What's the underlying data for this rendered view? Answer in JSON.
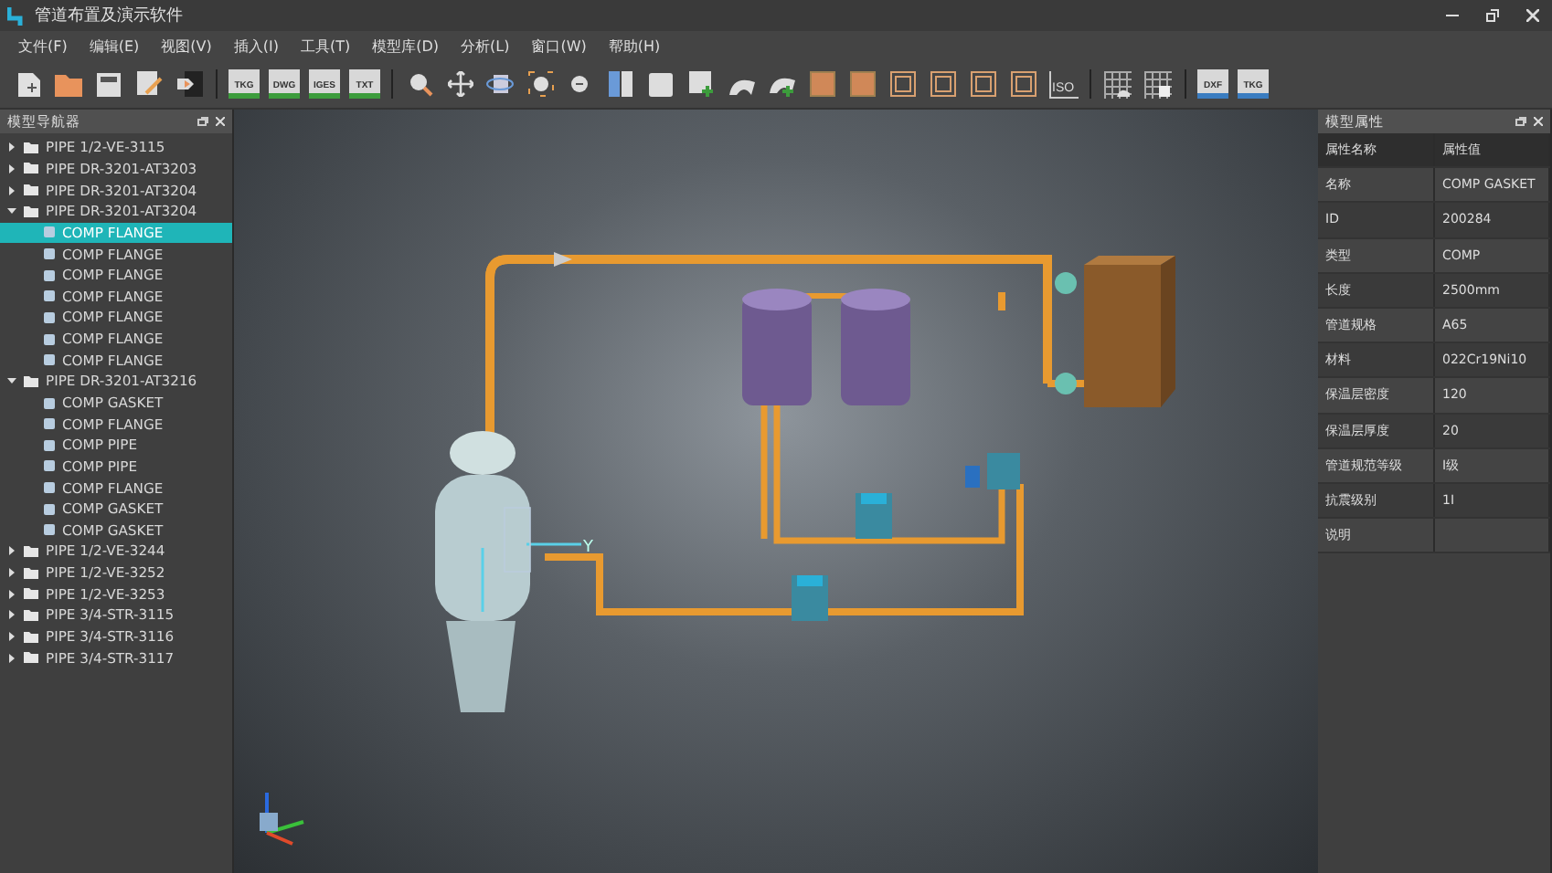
{
  "window": {
    "title": "管道布置及演示软件"
  },
  "menu": [
    "文件(F)",
    "编辑(E)",
    "视图(V)",
    "插入(I)",
    "工具(T)",
    "模型库(D)",
    "分析(L)",
    "窗口(W)",
    "帮助(H)"
  ],
  "toolbar": [
    [
      {
        "kind": "new"
      },
      {
        "kind": "open"
      },
      {
        "kind": "save"
      },
      {
        "kind": "edit"
      },
      {
        "kind": "import"
      }
    ],
    [
      {
        "kind": "file",
        "label": "TKG"
      },
      {
        "kind": "file",
        "label": "DWG"
      },
      {
        "kind": "file",
        "label": "IGES"
      },
      {
        "kind": "file",
        "label": "TXT"
      }
    ],
    [
      {
        "kind": "zoom"
      },
      {
        "kind": "pan"
      },
      {
        "kind": "rotate"
      },
      {
        "kind": "fit"
      },
      {
        "kind": "zoomout"
      },
      {
        "kind": "split"
      },
      {
        "kind": "cube"
      },
      {
        "kind": "cubeadd"
      },
      {
        "kind": "arc"
      },
      {
        "kind": "arcadd"
      },
      {
        "kind": "solid"
      },
      {
        "kind": "solid"
      },
      {
        "kind": "frame"
      },
      {
        "kind": "frame"
      },
      {
        "kind": "frame"
      },
      {
        "kind": "frame"
      },
      {
        "kind": "axis",
        "label": "ISO"
      }
    ],
    [
      {
        "kind": "grid"
      },
      {
        "kind": "grid2"
      }
    ],
    [
      {
        "kind": "file2",
        "label": "DXF"
      },
      {
        "kind": "file2",
        "label": "TKG"
      }
    ]
  ],
  "navigator": {
    "title": "模型导航器",
    "items": [
      {
        "label": "PIPE 1/2-VE-3115",
        "expanded": false,
        "selected": false
      },
      {
        "label": "PIPE DR-3201-AT3203",
        "expanded": false,
        "selected": false
      },
      {
        "label": "PIPE DR-3201-AT3204",
        "expanded": false,
        "selected": false
      },
      {
        "label": "PIPE DR-3201-AT3204",
        "expanded": true,
        "selected": false,
        "children": [
          {
            "label": "COMP FLANGE",
            "selected": true
          },
          {
            "label": "COMP FLANGE",
            "selected": false
          },
          {
            "label": "COMP FLANGE",
            "selected": false
          },
          {
            "label": "COMP FLANGE",
            "selected": false
          },
          {
            "label": "COMP FLANGE",
            "selected": false
          },
          {
            "label": "COMP FLANGE",
            "selected": false
          },
          {
            "label": "COMP FLANGE",
            "selected": false
          }
        ]
      },
      {
        "label": "PIPE DR-3201-AT3216",
        "expanded": true,
        "selected": false,
        "children": [
          {
            "label": "COMP GASKET",
            "selected": false
          },
          {
            "label": "COMP FLANGE",
            "selected": false
          },
          {
            "label": "COMP PIPE",
            "selected": false
          },
          {
            "label": "COMP PIPE",
            "selected": false
          },
          {
            "label": "COMP FLANGE",
            "selected": false
          },
          {
            "label": "COMP GASKET",
            "selected": false
          },
          {
            "label": "COMP GASKET",
            "selected": false
          }
        ]
      },
      {
        "label": "PIPE 1/2-VE-3244",
        "expanded": false,
        "selected": false
      },
      {
        "label": "PIPE 1/2-VE-3252",
        "expanded": false,
        "selected": false
      },
      {
        "label": "PIPE 1/2-VE-3253",
        "expanded": false,
        "selected": false
      },
      {
        "label": "PIPE 3/4-STR-3115",
        "expanded": false,
        "selected": false
      },
      {
        "label": "PIPE 3/4-STR-3116",
        "expanded": false,
        "selected": false
      },
      {
        "label": "PIPE 3/4-STR-3117",
        "expanded": false,
        "selected": false
      }
    ]
  },
  "viewport": {
    "axis_label": "Y"
  },
  "properties": {
    "title": "模型属性",
    "columns": [
      "属性名称",
      "属性值"
    ],
    "rows": [
      [
        "名称",
        "COMP GASKET"
      ],
      [
        "ID",
        "200284"
      ],
      [
        "类型",
        "COMP"
      ],
      [
        "长度",
        "2500mm"
      ],
      [
        "管道规格",
        "A65"
      ],
      [
        "材料",
        "022Cr19Ni10"
      ],
      [
        "保温层密度",
        "120"
      ],
      [
        "保温层厚度",
        "20"
      ],
      [
        "管道规范等级",
        "I级"
      ],
      [
        "抗震级别",
        "1I"
      ],
      [
        "说明",
        ""
      ]
    ]
  }
}
